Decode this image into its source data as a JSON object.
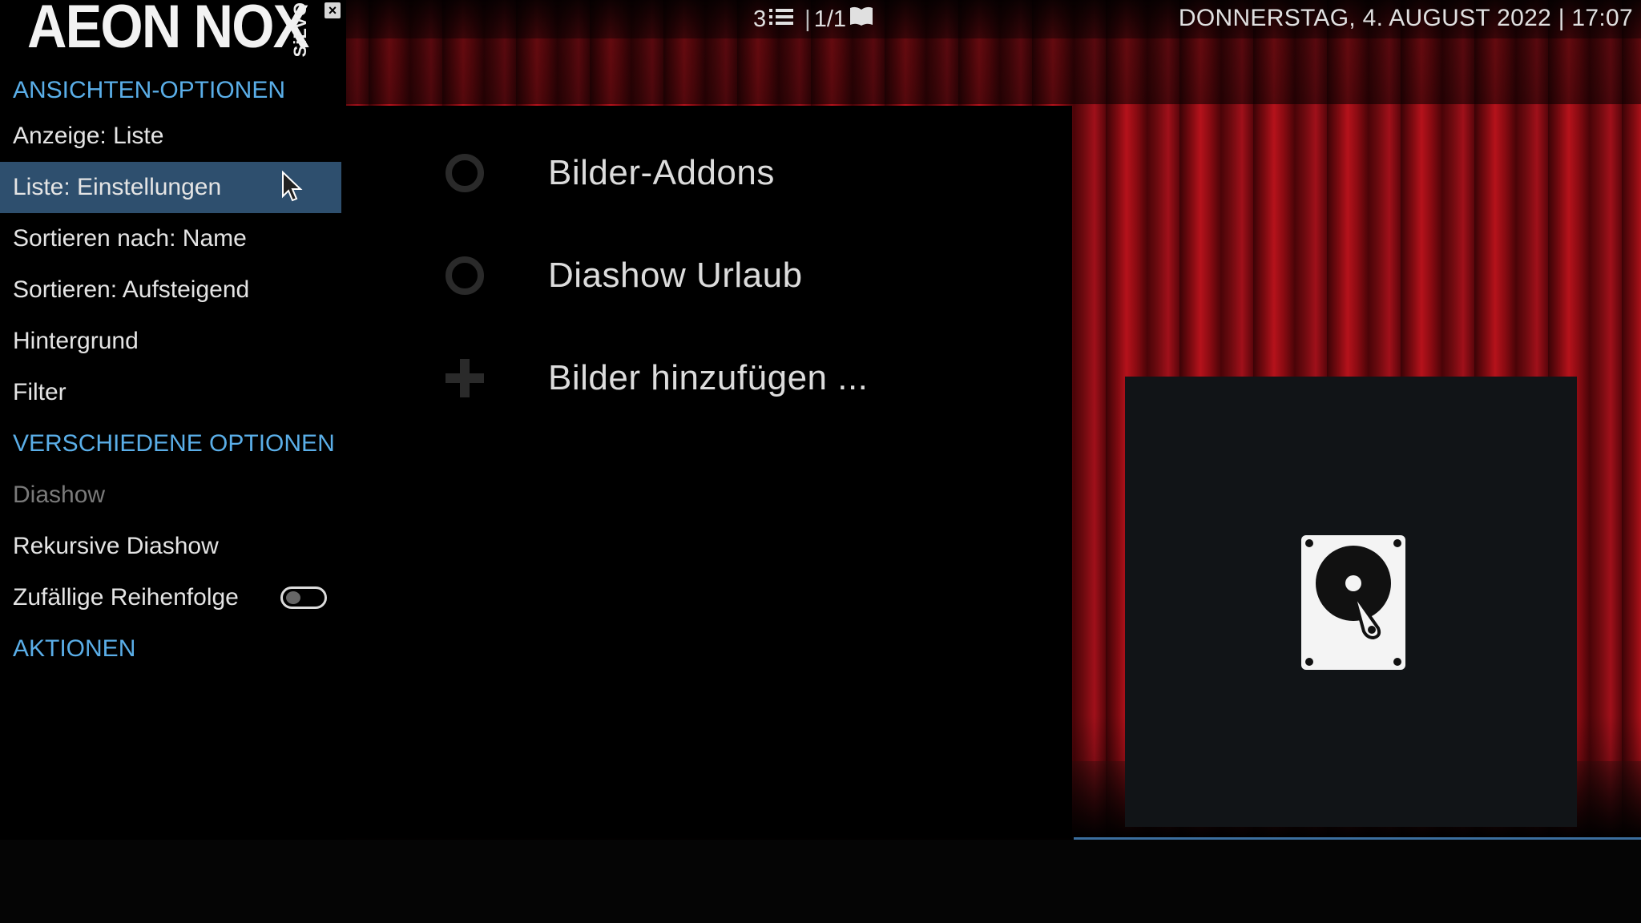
{
  "topbar": {
    "item_count": "3",
    "page": "1/1",
    "datetime": "DONNERSTAG, 4. AUGUST 2022 | 17:07"
  },
  "logo": {
    "text": "AEON NOX",
    "sub": "SiLVO"
  },
  "side_menu": {
    "sections": [
      {
        "kind": "header",
        "label": "ANSICHTEN-OPTIONEN"
      },
      {
        "kind": "item",
        "label": "Anzeige: Liste"
      },
      {
        "kind": "item",
        "label": "Liste: Einstellungen",
        "selected": true
      },
      {
        "kind": "item",
        "label": "Sortieren nach: Name"
      },
      {
        "kind": "item",
        "label": "Sortieren: Aufsteigend"
      },
      {
        "kind": "item",
        "label": "Hintergrund"
      },
      {
        "kind": "item",
        "label": "Filter"
      },
      {
        "kind": "header",
        "label": "VERSCHIEDENE OPTIONEN"
      },
      {
        "kind": "item",
        "label": "Diashow",
        "disabled": true
      },
      {
        "kind": "item",
        "label": "Rekursive Diashow"
      },
      {
        "kind": "item",
        "label": "Zufällige Reihenfolge",
        "toggle": "off"
      },
      {
        "kind": "header",
        "label": "AKTIONEN"
      }
    ]
  },
  "list": {
    "items": [
      {
        "label": "Bilder-Addons",
        "icon": "addons-icon"
      },
      {
        "label": "Diashow Urlaub",
        "icon": "drive-icon"
      },
      {
        "label": "Bilder hinzufügen ...",
        "icon": "plus-icon"
      }
    ]
  },
  "preview": {
    "icon": "hard-drive-icon"
  },
  "colors": {
    "header_accent": "#5aaee8",
    "selection": "#2e4f6e",
    "focus_line": "#3c6e9e"
  }
}
